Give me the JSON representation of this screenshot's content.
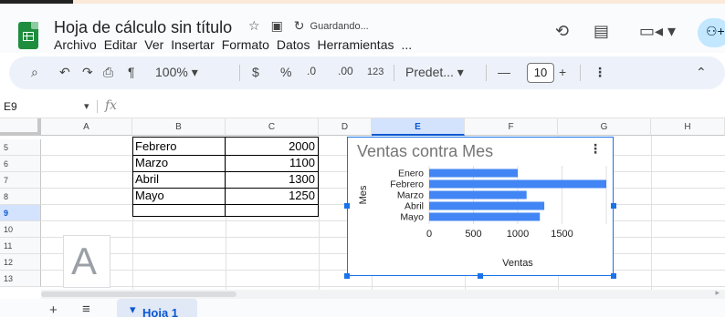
{
  "app": {
    "doc_title": "Hoja de cálculo sin título",
    "status": "Guardando...",
    "title_icons": [
      "star-icon",
      "move-to-folder-icon",
      "cloud-sync-icon"
    ],
    "menu": [
      "Archivo",
      "Editar",
      "Ver",
      "Insertar",
      "Formato",
      "Datos",
      "Herramientas",
      "..."
    ],
    "header_actions": [
      "history-icon",
      "comment-icon",
      "meet-icon",
      "share-icon"
    ]
  },
  "toolbar": {
    "zoom": "100%",
    "currency": "$",
    "percent": "%",
    "dec_decrease": ".0",
    "dec_increase": ".00",
    "number_format": "123",
    "font": "Predet...",
    "font_size": "10",
    "minus": "—",
    "plus": "+"
  },
  "formula_bar": {
    "cell_ref": "E9",
    "fx": "fx",
    "value": ""
  },
  "grid": {
    "columns": [
      "A",
      "B",
      "C",
      "D",
      "E",
      "F",
      "G",
      "H"
    ],
    "selected_column": "E",
    "rows": [
      "5",
      "6",
      "7",
      "8",
      "9",
      "10",
      "11",
      "12",
      "13"
    ],
    "selected_row": "9",
    "table": [
      {
        "month": "Febrero",
        "sales": "2000"
      },
      {
        "month": "Marzo",
        "sales": "1100"
      },
      {
        "month": "Abril",
        "sales": "1300"
      },
      {
        "month": "Mayo",
        "sales": "1250"
      }
    ]
  },
  "floating_image_text": "A",
  "sheet_tab": "Hoja 1",
  "chart_data": {
    "type": "bar",
    "orientation": "horizontal",
    "title": "Ventas contra Mes",
    "xlabel": "Ventas",
    "ylabel": "Mes",
    "categories": [
      "Enero",
      "Febrero",
      "Marzo",
      "Abril",
      "Mayo"
    ],
    "values": [
      1000,
      2000,
      1100,
      1300,
      1250
    ],
    "xticks": [
      "0",
      "500",
      "1000",
      "1500"
    ],
    "xlim": [
      0,
      2000
    ],
    "grid": true,
    "legend": "none",
    "bar_color": "#4285f4"
  },
  "colors": {
    "accent": "#0b57d0",
    "selection": "#d3e3fd",
    "chart_border": "#1a73e8",
    "bar": "#4285f4"
  }
}
